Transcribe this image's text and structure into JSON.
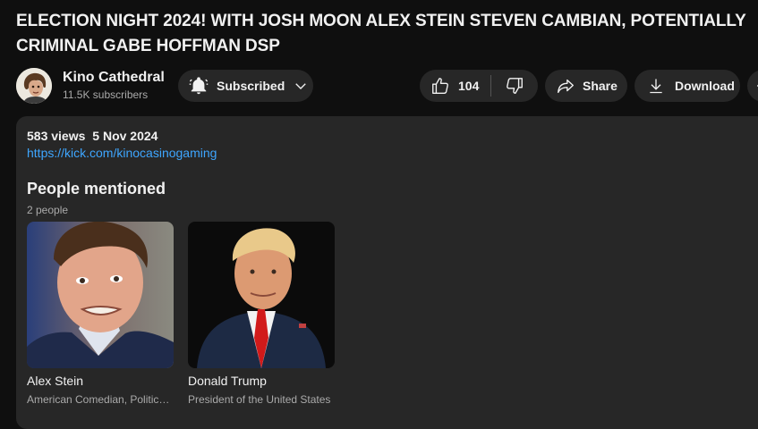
{
  "video": {
    "title": "ELECTION NIGHT 2024! WITH JOSH MOON ALEX STEIN STEVEN CAMBIAN, POTENTIALLY CRIMINAL GABE HOFFMAN DSP"
  },
  "channel": {
    "name": "Kino Cathedral",
    "subscribers": "11.5K subscribers",
    "subscribe_label": "Subscribed"
  },
  "actions": {
    "like_count": "104",
    "share_label": "Share",
    "download_label": "Download"
  },
  "description": {
    "views": "583 views",
    "date": "5 Nov 2024",
    "link": "https://kick.com/kinocasinogaming"
  },
  "people": {
    "title": "People mentioned",
    "count": "2 people",
    "items": [
      {
        "name": "Alex Stein",
        "role": "American Comedian, Political Commentator"
      },
      {
        "name": "Donald Trump",
        "role": "President of the United States"
      }
    ]
  },
  "icons": {
    "subscribe": "bell-ringing-icon",
    "dropdown": "chevron-down-icon",
    "like": "thumbs-up-icon",
    "dislike": "thumbs-down-icon",
    "share": "share-arrow-icon",
    "download": "download-icon",
    "more": "more-icon"
  },
  "colors": {
    "background": "#0f0f0f",
    "surface": "#272727",
    "link": "#3ea6ff",
    "secondary_text": "#aaaaaa"
  }
}
